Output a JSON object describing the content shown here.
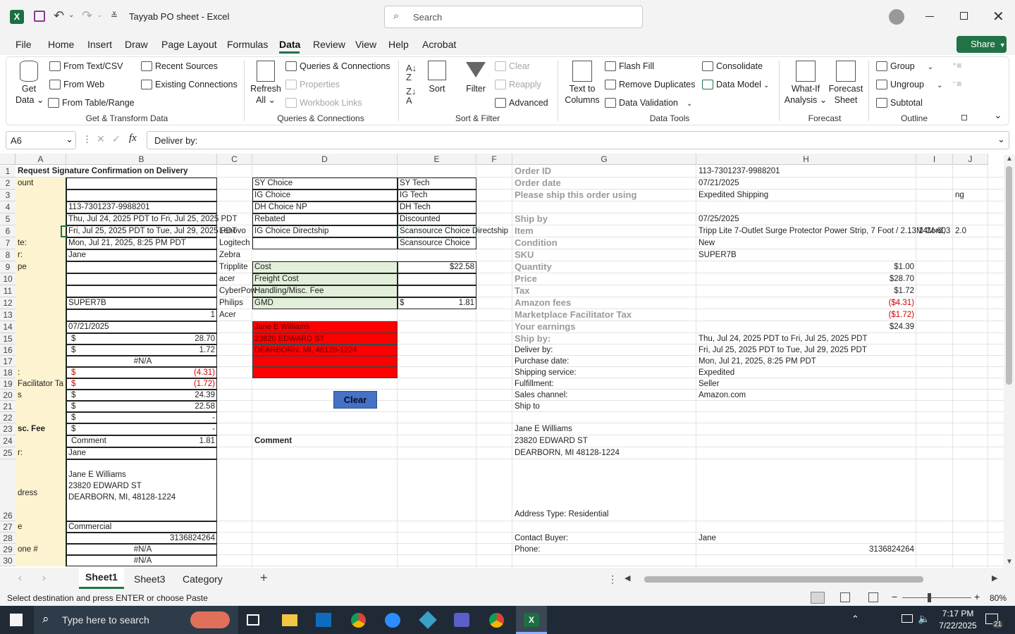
{
  "app": {
    "title": "Tayyab PO sheet  -  Excel",
    "search_placeholder": "Search"
  },
  "menu": [
    "File",
    "Home",
    "Insert",
    "Draw",
    "Page Layout",
    "Formulas",
    "Data",
    "Review",
    "View",
    "Help",
    "Acrobat"
  ],
  "share": "Share",
  "ribbon": {
    "get_data": "Get\nData ⌄",
    "from_text": "From Text/CSV",
    "from_web": "From Web",
    "from_table": "From Table/Range",
    "recent": "Recent Sources",
    "existing": "Existing Connections",
    "grp1": "Get & Transform Data",
    "refresh": "Refresh\nAll ⌄",
    "queries": "Queries & Connections",
    "properties": "Properties",
    "links": "Workbook Links",
    "grp2": "Queries & Connections",
    "sort": "Sort",
    "filter": "Filter",
    "clear": "Clear",
    "reapply": "Reapply",
    "advanced": "Advanced",
    "grp3": "Sort & Filter",
    "text_cols": "Text to\nColumns",
    "flash": "Flash Fill",
    "dupes": "Remove Duplicates",
    "validation": "Data Validation",
    "consolidate": "Consolidate",
    "model": "Data Model",
    "grp4": "Data Tools",
    "whatif": "What-If\nAnalysis ⌄",
    "forecast": "Forecast\nSheet",
    "grp5": "Forecast",
    "group": "Group",
    "ungroup": "Ungroup",
    "subtotal": "Subtotal",
    "grp6": "Outline"
  },
  "formula": {
    "namebox": "A6",
    "content": "Deliver by:"
  },
  "columns": [
    [
      "A",
      22,
      72
    ],
    [
      "B",
      94,
      214
    ],
    [
      "C",
      308,
      50
    ],
    [
      "D",
      358,
      206
    ],
    [
      "E",
      564,
      112
    ],
    [
      "F",
      676,
      51
    ],
    [
      "G",
      727,
      261
    ],
    [
      "H",
      988,
      312
    ],
    [
      "I",
      1300,
      52
    ],
    [
      "J",
      1352,
      50
    ]
  ],
  "rows": [
    "1",
    "2",
    "3",
    "4",
    "5",
    "6",
    "7",
    "8",
    "9",
    "10",
    "11",
    "12",
    "13",
    "14",
    "15",
    "16",
    "17",
    "18",
    "19",
    "20",
    "21",
    "22",
    "23",
    "24",
    "25",
    "26",
    "27",
    "28",
    "29",
    "30"
  ],
  "cells": {
    "a1": "Request Signature Confirmation on Delivery",
    "a2": "ount",
    "a7": "te:",
    "a8": "r:",
    "a9": "pe",
    "a18": ":",
    "a19": " Facilitator Ta",
    "a20": "s",
    "a23": "sc. Fee",
    "a25": "r:",
    "a26": "dress",
    "a27": "e",
    "a29": "one #",
    "b4": "113-7301237-9988201",
    "b5": "Thu, Jul 24, 2025 PDT to Fri, Jul 25, 2025 PDT",
    "b6": "Fri, Jul 25, 2025 PDT to Tue, Jul 29, 2025 PDT",
    "b7": "Mon, Jul 21, 2025, 8:25 PM PDT",
    "b8": "Jane",
    "b12": "SUPER7B",
    "b13": "1",
    "b14": "07/21/2025",
    "d15": "$",
    "b15": "28.70",
    "d16": "$",
    "b16": "1.72",
    "b17": "#N/A",
    "d18": "$",
    "b18": "(4.31)",
    "d19": "$",
    "b19": "(1.72)",
    "d20": "$",
    "b20": "24.39",
    "d21": "$",
    "b21": "22.58",
    "d22": "$",
    "b22": "-",
    "d23": "$",
    "b23": "-",
    "d24": "Comment",
    "b24": "1.81",
    "b25": "Jane",
    "b26a": "Jane E Williams",
    "b26b": "23820 EDWARD ST",
    "b26c": "DEARBORN, MI, 48128-1224",
    "b27": "Commercial",
    "b28": "3136824264",
    "b29": "#N/A",
    "b30": "#N/A",
    "c6": "Lenovo",
    "c7": "Logitech",
    "c8": "Zebra",
    "c9": "Tripplite",
    "c10": "acer",
    "c11": "CyberPow",
    "c12": "Philips",
    "c13": "Acer",
    "d2": "SY Choice",
    "d3": "IG Choice",
    "d4": "DH Choice NP",
    "d5": " Rebated",
    "d6": "IG Choice Directship",
    "d9": "Cost",
    "d10": "Freight Cost",
    "d11": "Handling/Misc. Fee",
    "d12": "GMD",
    "d14": "Jane E Williams",
    "d15b": "23820 EDWARD ST",
    "d16b": "DEARBORN, MI, 48128-1224",
    "e2": "SY Tech",
    "e3": "IG Tech",
    "e4": "DH Tech",
    "e5": " Discounted",
    "e6": "Scansource Choice Directship",
    "e7": "Scansource Choice",
    "e9": "$22.58",
    "e12a": "$",
    "e12": "1.81",
    "clear_btn": "Clear",
    "g1": "Order ID",
    "g2": "Order date",
    "g3": "Please ship this order using",
    "g5": "Ship by",
    "g6": "Item",
    "g7": "Condition",
    "g8": "SKU",
    "g9": "Quantity",
    "g10": "Price",
    "g11": "Tax",
    "g12": "Amazon fees",
    "g13": "Marketplace Facilitator Tax",
    "g14": "Your earnings",
    "g15": "Ship by:",
    "g16": "Deliver by:",
    "g17": "Purchase date:",
    "g18": "Shipping service:",
    "g19": "Fulfillment:",
    "g20": "Sales channel:",
    "g21": "Ship to",
    "g23": "Jane E Williams",
    "g24": "23820 EDWARD ST",
    "g25": "DEARBORN, MI 48128-1224",
    "g26": "Address Type:  Residential",
    "g28": "Contact Buyer:",
    "g29": "Phone:",
    "h1": "113-7301237-9988201",
    "h2": "07/21/2025",
    "h3": "Expedited Shipping",
    "h5": "07/25/2025",
    "h6": "Tripp Lite 7-Outlet Surge Protector Power Strip, 7 Foot / 2.13M Cord,",
    "h7": "New",
    "h8": "SUPER7B",
    "h9": "$1.00",
    "h10": "$28.70",
    "h11": "$1.72",
    "h12": "($4.31)",
    "h13": "($1.72)",
    "h14": "$24.39",
    "h15": "Thu, Jul 24, 2025 PDT to Fri, Jul 25, 2025 PDT",
    "h16": "Fri, Jul 25, 2025 PDT to Tue, Jul 29, 2025 PDT",
    "h17": "Mon, Jul 21, 2025, 8:25 PM PDT",
    "h18": "Expedited",
    "h19": "Seller",
    "h20": "Amazon.com",
    "h28": "Jane",
    "h29": "3136824264",
    "i6": "14M-603",
    "j3": "ng",
    "j6": "2.0"
  },
  "sheets": [
    "Sheet1",
    "Sheet3",
    "Category"
  ],
  "status": {
    "message": "Select destination and press ENTER or choose Paste",
    "zoom": "80%"
  },
  "taskbar": {
    "search": "Type here to search",
    "time": "7:17 PM",
    "date": "7/22/2025",
    "badge": "21"
  },
  "colors": {
    "accent": "#217346",
    "highlight": "#fdf3d0",
    "green_cell": "#e2efda",
    "red_block": "#ff0000",
    "clear_btn": "#4472c4"
  }
}
